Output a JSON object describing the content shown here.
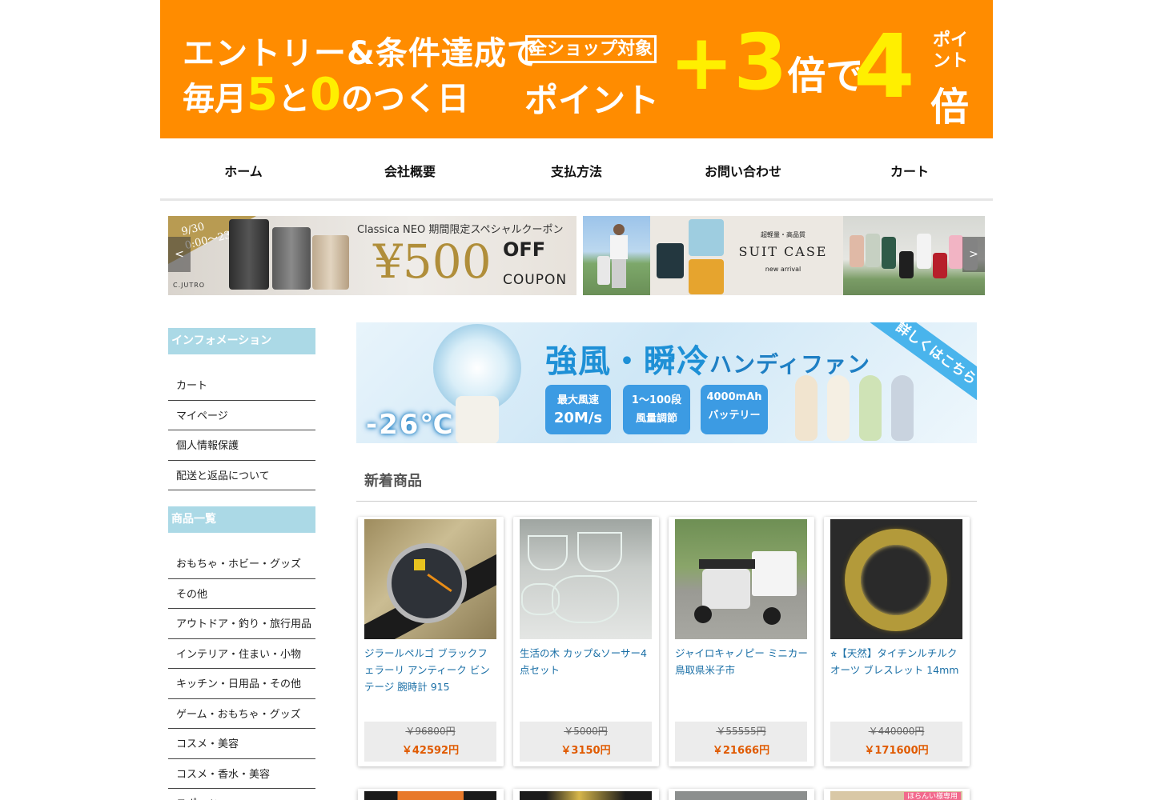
{
  "campaign": {
    "line1": "エントリー&条件達成で",
    "line2_a": "毎月",
    "line2_five": "5",
    "line2_to": "と",
    "line2_zero": "0",
    "line2_b": "のつく日",
    "box": "全ショップ対象",
    "point": "ポイント",
    "plus": "+3",
    "bai": "倍で",
    "four": "4",
    "small": "ポイント",
    "bai2": "倍"
  },
  "nav": [
    "ホーム",
    "会社概要",
    "支払方法",
    "お問い合わせ",
    "カート"
  ],
  "slider": {
    "slide1": {
      "date": "9/30\n0:00〜23:59",
      "brand": "C.JUTRO",
      "title": "Classica NEO 期間限定スペシャルクーポン",
      "amount": "¥500",
      "off": "OFF",
      "coupon": "COUPON"
    },
    "slide2": {
      "sub": "超軽量・高品質",
      "title": "SUIT CASE",
      "tagline": "new arrival"
    },
    "prev": "<",
    "next": ">"
  },
  "sidebar": {
    "info_title": "インフォメーション",
    "info_items": [
      "カート",
      "マイページ",
      "個人情報保護",
      "配送と返品について"
    ],
    "cat_title": "商品一覧",
    "cat_items": [
      "おもちゃ・ホビー・グッズ",
      "その他",
      "アウトドア・釣り・旅行用品",
      "インテリア・住まい・小物",
      "キッチン・日用品・その他",
      "ゲーム・おもちゃ・グッズ",
      "コスメ・美容",
      "コスメ・香水・美容",
      "スポーツ"
    ]
  },
  "fan_banner": {
    "title": "強風・瞬冷",
    "title_small": "ハンディファン",
    "ribbon": "詳しくはこちら",
    "temp": "-26℃",
    "badges": [
      {
        "top": "最大風速",
        "value": "20M/s"
      },
      {
        "top": "1〜100段",
        "value": "風量調節"
      },
      {
        "top": "4000mAh",
        "value": "バッテリー"
      }
    ]
  },
  "section": {
    "title": "新着商品"
  },
  "products": [
    {
      "name": "ジラールペルゴ ブラックフェラーリ アンティーク ビンテージ 腕時計 915",
      "old_price": "￥96800円",
      "price": "￥42592円"
    },
    {
      "name": "生活の木 カップ&ソーサー4点セット",
      "old_price": "￥5000円",
      "price": "￥3150円"
    },
    {
      "name": "ジャイロキャノピー ミニカー 鳥取県米子市",
      "old_price": "￥55555円",
      "price": "￥21666円"
    },
    {
      "name": "⭐︎【天然】タイチンルチルクオーツ ブレスレット 14mm",
      "old_price": "￥440000円",
      "price": "￥171600円"
    }
  ],
  "next_row_tag": "ほらんい様専用",
  "colors": {
    "campaign_bg": "#ff8c00",
    "campaign_yellow": "#ffef00",
    "sidebar_head": "#abd9e6",
    "product_link": "#1a6fa6",
    "sale_price": "#e05a00"
  }
}
